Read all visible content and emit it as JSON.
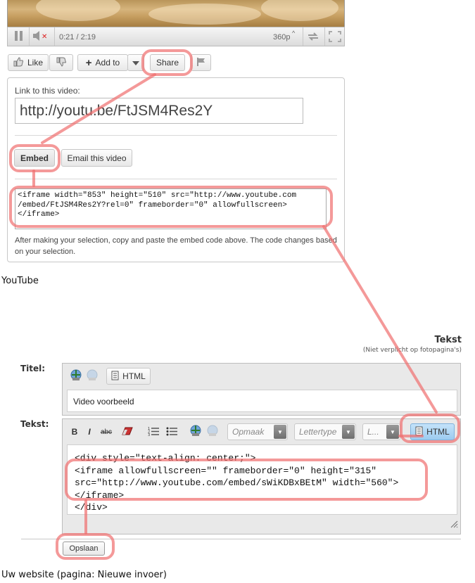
{
  "player": {
    "time": "0:21 / 2:19",
    "quality": "360p",
    "quality_arrow": "^"
  },
  "actions": {
    "like_label": "Like",
    "add_to_label": "Add to",
    "share_label": "Share"
  },
  "share_panel": {
    "link_label": "Link to this video:",
    "link_value": "http://youtu.be/FtJSM4Res2Y",
    "embed_label": "Embed",
    "email_label": "Email this video",
    "embed_code": "<iframe width=\"853\" height=\"510\" src=\"http://www.youtube.com\n/embed/FtJSM4Res2Y?rel=0\" frameborder=\"0\" allowfullscreen>\n</iframe>",
    "help_text": "After making your selection, copy and paste the embed code above. The code changes based on your selection."
  },
  "caption_youtube": "YouTube",
  "cms": {
    "section_title": "Tekst",
    "section_subtitle": "(Niet verplicht op fotopagina's)",
    "title_label": "Titel:",
    "title_html_label": "HTML",
    "title_value": "Video voorbeeld",
    "text_label": "Tekst:",
    "bold_label": "B",
    "italic_label": "I",
    "strike_label": "abc",
    "format_placeholder": "Opmaak",
    "font_placeholder": "Lettertype",
    "size_placeholder": "L...",
    "text_html_label": "HTML",
    "code": "<div style=\"text-align: center;\">\n<iframe allowfullscreen=\"\" frameborder=\"0\" height=\"315\"\nsrc=\"http://www.youtube.com/embed/sWiKDBxBEtM\" width=\"560\">\n</iframe>\n</div>",
    "save_label": "Opslaan"
  },
  "caption_website": "Uw website (pagina: Nieuwe invoer)",
  "colors": {
    "highlight": "#f06e6e",
    "html_active": "#aad4f5"
  }
}
